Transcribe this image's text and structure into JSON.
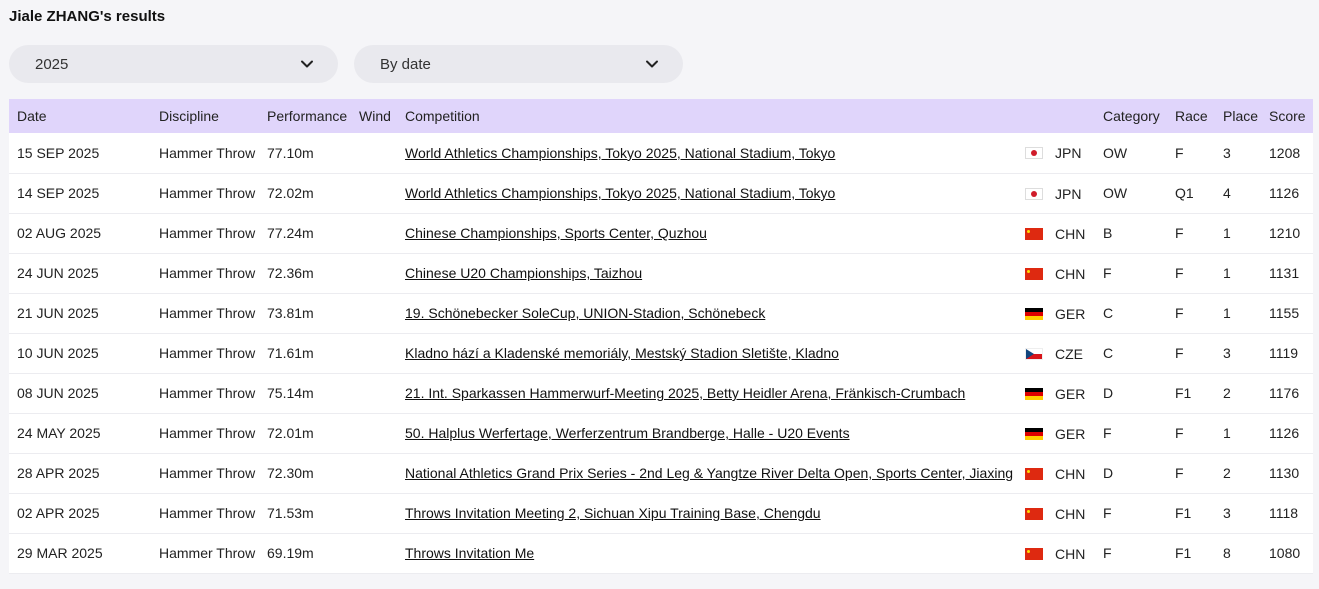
{
  "page": {
    "title": "Jiale ZHANG's results"
  },
  "filters": {
    "year": "2025",
    "sort": "By date"
  },
  "table": {
    "headers": {
      "date": "Date",
      "discipline": "Discipline",
      "performance": "Performance",
      "wind": "Wind",
      "competition": "Competition",
      "category": "Category",
      "race": "Race",
      "place": "Place",
      "score": "Score"
    },
    "rows": [
      {
        "date": "15 SEP 2025",
        "discipline": "Hammer Throw",
        "performance": "77.10m",
        "wind": "",
        "competition": "World Athletics Championships, Tokyo 2025, National Stadium, Tokyo",
        "country": "JPN",
        "flag": "jpn",
        "category": "OW",
        "race": "F",
        "place": "3",
        "score": "1208"
      },
      {
        "date": "14 SEP 2025",
        "discipline": "Hammer Throw",
        "performance": "72.02m",
        "wind": "",
        "competition": "World Athletics Championships, Tokyo 2025, National Stadium, Tokyo",
        "country": "JPN",
        "flag": "jpn",
        "category": "OW",
        "race": "Q1",
        "place": "4",
        "score": "1126"
      },
      {
        "date": "02 AUG 2025",
        "discipline": "Hammer Throw",
        "performance": "77.24m",
        "wind": "",
        "competition": "Chinese Championships, Sports Center, Quzhou",
        "country": "CHN",
        "flag": "chn",
        "category": "B",
        "race": "F",
        "place": "1",
        "score": "1210"
      },
      {
        "date": "24 JUN 2025",
        "discipline": "Hammer Throw",
        "performance": "72.36m",
        "wind": "",
        "competition": "Chinese U20 Championships, Taizhou",
        "country": "CHN",
        "flag": "chn",
        "category": "F",
        "race": "F",
        "place": "1",
        "score": "1131"
      },
      {
        "date": "21 JUN 2025",
        "discipline": "Hammer Throw",
        "performance": "73.81m",
        "wind": "",
        "competition": "19. Schönebecker SoleCup, UNION-Stadion, Schönebeck",
        "country": "GER",
        "flag": "ger",
        "category": "C",
        "race": "F",
        "place": "1",
        "score": "1155"
      },
      {
        "date": "10 JUN 2025",
        "discipline": "Hammer Throw",
        "performance": "71.61m",
        "wind": "",
        "competition": "Kladno hází a Kladenské memoriály, Mestský Stadion Sletište, Kladno",
        "country": "CZE",
        "flag": "cze",
        "category": "C",
        "race": "F",
        "place": "3",
        "score": "1119"
      },
      {
        "date": "08 JUN 2025",
        "discipline": "Hammer Throw",
        "performance": "75.14m",
        "wind": "",
        "competition": "21. Int. Sparkassen Hammerwurf-Meeting 2025, Betty Heidler Arena, Fränkisch-Crumbach",
        "country": "GER",
        "flag": "ger",
        "category": "D",
        "race": "F1",
        "place": "2",
        "score": "1176"
      },
      {
        "date": "24 MAY 2025",
        "discipline": "Hammer Throw",
        "performance": "72.01m",
        "wind": "",
        "competition": "50. Halplus Werfertage, Werferzentrum Brandberge, Halle - U20 Events",
        "country": "GER",
        "flag": "ger",
        "category": "F",
        "race": "F",
        "place": "1",
        "score": "1126"
      },
      {
        "date": "28 APR 2025",
        "discipline": "Hammer Throw",
        "performance": "72.30m",
        "wind": "",
        "competition": "National Athletics Grand Prix Series - 2nd Leg & Yangtze River Delta Open, Sports Center, Jiaxing",
        "country": "CHN",
        "flag": "chn",
        "category": "D",
        "race": "F",
        "place": "2",
        "score": "1130"
      },
      {
        "date": "02 APR 2025",
        "discipline": "Hammer Throw",
        "performance": "71.53m",
        "wind": "",
        "competition": "Throws Invitation Meeting 2, Sichuan Xipu Training Base, Chengdu",
        "country": "CHN",
        "flag": "chn",
        "category": "F",
        "race": "F1",
        "place": "3",
        "score": "1118"
      },
      {
        "date": "29 MAR 2025",
        "discipline": "Hammer Throw",
        "performance": "69.19m",
        "wind": "",
        "competition": "Throws Invitation Me",
        "country": "CHN",
        "flag": "chn",
        "category": "F",
        "race": "F1",
        "place": "8",
        "score": "1080"
      }
    ]
  }
}
